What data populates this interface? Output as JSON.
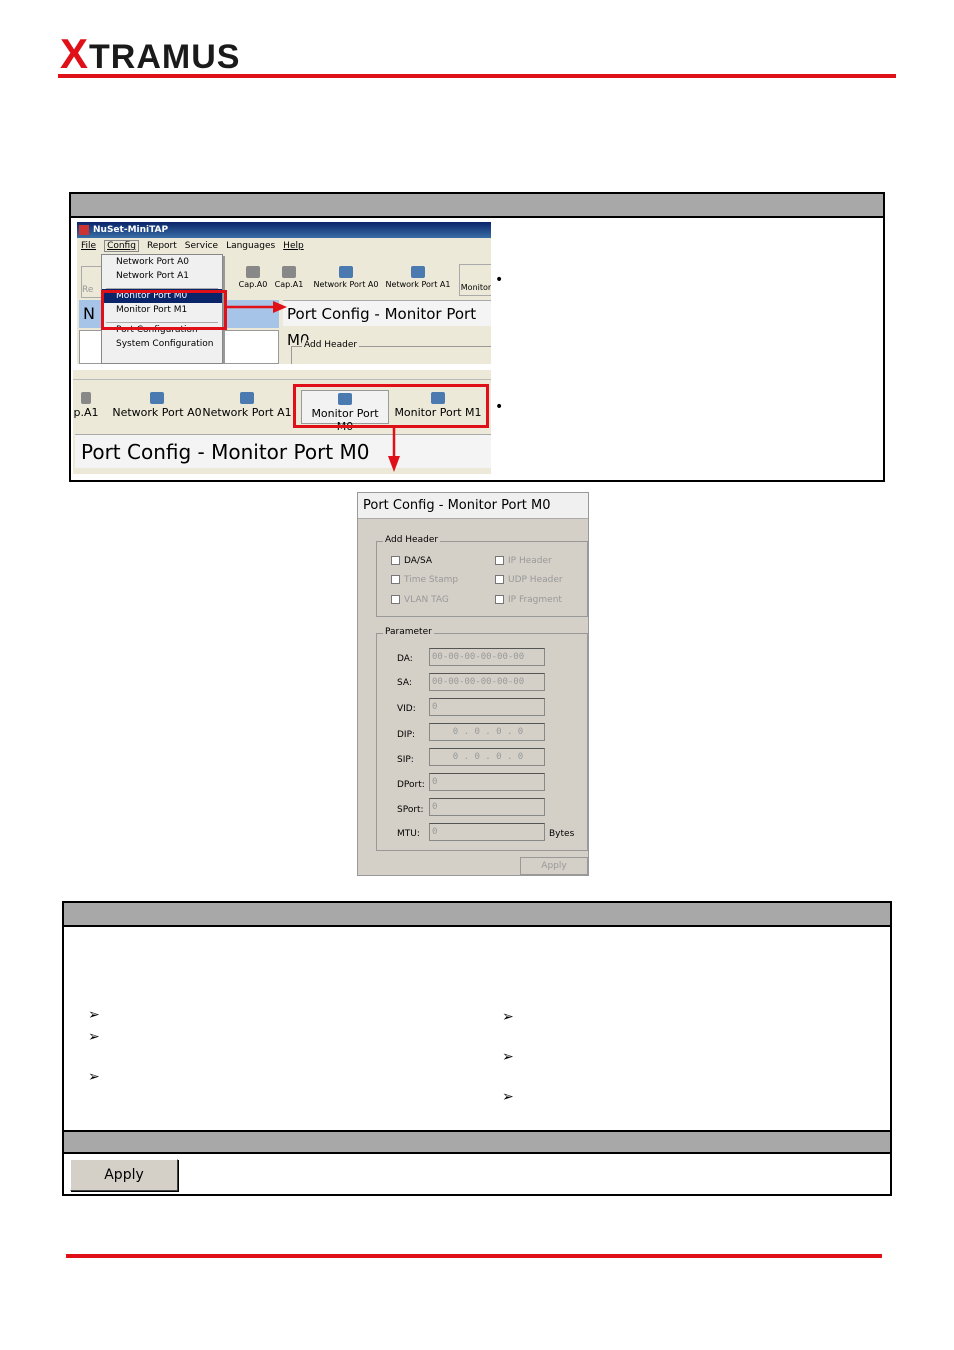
{
  "logo": {
    "x_letter": "X",
    "rest": "TRAMUS"
  },
  "app": {
    "title": "NuSet-MiniTAP",
    "menu": [
      "File",
      "Config",
      "Report",
      "Service",
      "Languages",
      "Help"
    ],
    "dropdown": [
      "Network Port A0",
      "Network Port A1",
      "Monitor Port M0",
      "Monitor Port M1",
      "Port Configuration",
      "System Configuration"
    ],
    "toolbar_small": [
      "Cap.A0",
      "Cap.A1",
      "Network Port A0",
      "Network Port A1",
      "Monitor"
    ],
    "toolbar_large": [
      "Network Port A0",
      "Network Port A1",
      "Monitor Port M0",
      "Monitor Port M1"
    ],
    "toolbar_left_cut": "p.A1",
    "port_config_title": "Port Config - Monitor Port M0",
    "add_header": "Add Header",
    "left_cut": "Re",
    "left_cut2": "N"
  },
  "config_panel": {
    "title": "Port Config - Monitor Port M0",
    "add_header": "Add Header",
    "checkboxes": [
      "DA/SA",
      "IP Header",
      "Time Stamp",
      "UDP Header",
      "VLAN TAG",
      "IP Fragment"
    ],
    "parameter": "Parameter",
    "fields": [
      {
        "label": "DA:",
        "value": "00-00-00-00-00-00"
      },
      {
        "label": "SA:",
        "value": "00-00-00-00-00-00"
      },
      {
        "label": "VID:",
        "value": "0"
      },
      {
        "label": "DIP:",
        "value": "0 . 0 . 0 . 0"
      },
      {
        "label": "SIP:",
        "value": "0 . 0 . 0 . 0"
      },
      {
        "label": "DPort:",
        "value": "0"
      },
      {
        "label": "SPort:",
        "value": "0"
      },
      {
        "label": "MTU:",
        "value": "0"
      }
    ],
    "bytes": "Bytes",
    "apply": "Apply"
  },
  "apply_button": "Apply",
  "colors": {
    "accent": "#e01018",
    "selection": "#0a246a",
    "panel": "#d4d0c8"
  }
}
